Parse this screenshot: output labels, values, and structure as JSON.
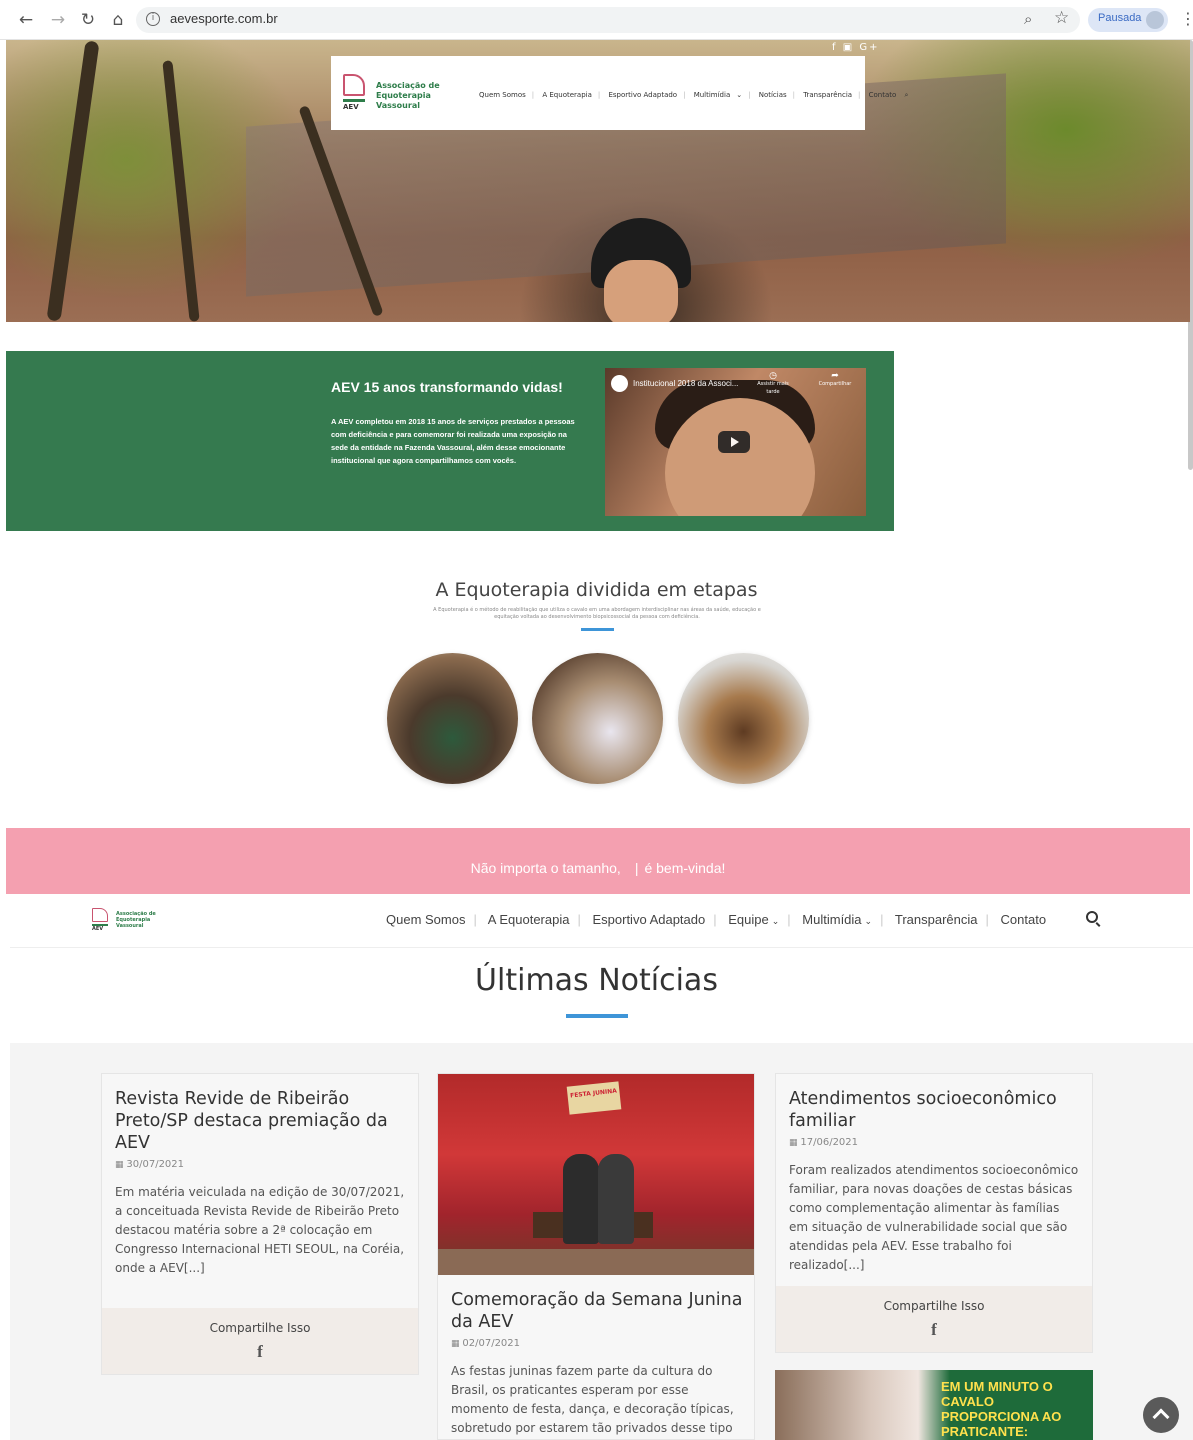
{
  "browser": {
    "url": "aevesporte.com.br",
    "profile_status": "Pausada"
  },
  "hero": {
    "social": "f ▣ G+",
    "logo": {
      "abbr": "AEV",
      "name": "Associação de Equoterapia Vassoural"
    },
    "nav": [
      "Quem Somos",
      "A Equoterapia",
      "Esportivo Adaptado",
      "Multimídia",
      "Notícias",
      "Transparência",
      "Contato"
    ]
  },
  "feature": {
    "title": "AEV 15 anos transformando vidas!",
    "text": "A AEV completou em 2018 15 anos de serviços prestados a pessoas com deficiência e para comemorar foi realizada uma exposição na sede da entidade na Fazenda Vassoural, além desse emocionante institucional que agora compartilhamos com vocês.",
    "video": {
      "title": "Institucional 2018 da Associ...",
      "watch_later": "Assistir mais tarde",
      "share": "Compartilhar"
    }
  },
  "steps": {
    "title": "A Equoterapia dividida em etapas",
    "description": "A Equoterapia é o método de reabilitação que utiliza o cavalo em uma abordagem interdisciplinar nas áreas da saúde, educação e equitação voltada ao desenvolvimento biopsicossocial da pessoa com deficiência."
  },
  "banner": {
    "part1": "Não importa o tamanho,",
    "part2": "é bem-vinda!"
  },
  "sticky_nav": {
    "logo_abbr": "AEV",
    "logo_name": "Associação de Equoterapia Vassoural",
    "links": [
      "Quem Somos",
      "A Equoterapia",
      "Esportivo Adaptado",
      "Equipe",
      "Multimídia",
      "Transparência",
      "Contato"
    ]
  },
  "news": {
    "title": "Últimas Notícias",
    "share_label": "Compartilhe Isso",
    "share_icon": "f",
    "items": [
      {
        "title": "Revista Revide de Ribeirão Preto/SP destaca premiação da AEV",
        "date": "30/07/2021",
        "excerpt": "Em matéria veiculada na edição de 30/07/2021, a conceituada Revista Revide de Ribeirão Preto destacou matéria sobre a 2ª colocação em Congresso Internacional HETI SEOUL, na Coréia, onde a AEV[...]"
      },
      {
        "title": "Comemoração da Semana Junina da AEV",
        "date": "02/07/2021",
        "excerpt": "As festas juninas fazem parte da cultura do Brasil, os praticantes esperam por esse momento de festa, dança, e decoração típicas, sobretudo por estarem tão privados desse tipo de evento[...]",
        "photo_sign": "FESTA JUNINA"
      },
      {
        "title": "Atendimentos socioeconômico familiar",
        "date": "17/06/2021",
        "excerpt": "Foram realizados atendimentos socioeconômico familiar, para novas doações de cestas básicas como complementação alimentar às famílias em situação de vulnerabilidade social que são atendidas pela AEV. Esse trabalho foi realizado[...]"
      }
    ],
    "promo": "EM UM MINUTO O CAVALO PROPORCIONA AO PRATICANTE:"
  },
  "colors": {
    "green": "#357a4f",
    "pink": "#f4a0b0",
    "accent_blue": "#3e95d8"
  }
}
